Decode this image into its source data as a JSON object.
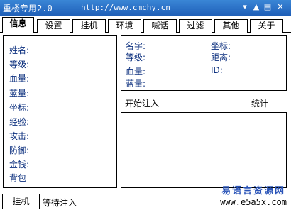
{
  "titlebar": {
    "title": "重楼专用2.0",
    "url": "http://www.cmchy.cn"
  },
  "tabs": [
    "信息",
    "设置",
    "挂机",
    "环境",
    "喊话",
    "过滤",
    "其他",
    "关于"
  ],
  "left_panel": {
    "labels": [
      "姓名:",
      "等级:",
      "血量:",
      "蓝量:",
      "坐标:",
      "经验:",
      "攻击:",
      "防御:",
      "金钱:",
      "背包"
    ]
  },
  "target_panel": {
    "col1": [
      "名字:",
      "等级:",
      "血量:",
      "蓝量:"
    ],
    "col2": [
      "坐标:",
      "距离:",
      "ID:"
    ]
  },
  "inject": {
    "start_label": "开始注入",
    "stats_label": "统计"
  },
  "status": {
    "button_label": "挂机",
    "text": "等待注入"
  },
  "watermark": {
    "cn": "易语言资源网",
    "url": "www.e5a5x.com"
  }
}
